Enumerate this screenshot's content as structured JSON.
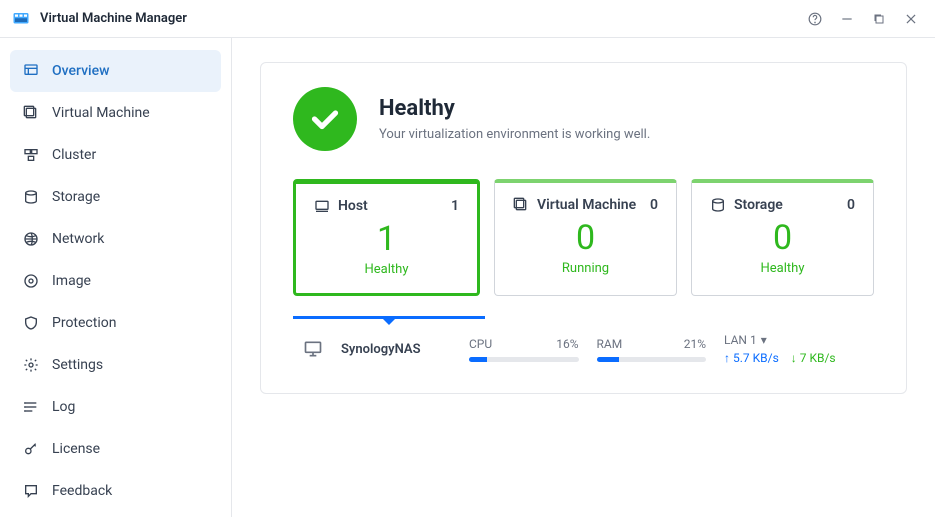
{
  "app": {
    "title": "Virtual Machine Manager"
  },
  "sidebar": {
    "items": [
      {
        "label": "Overview"
      },
      {
        "label": "Virtual Machine"
      },
      {
        "label": "Cluster"
      },
      {
        "label": "Storage"
      },
      {
        "label": "Network"
      },
      {
        "label": "Image"
      },
      {
        "label": "Protection"
      },
      {
        "label": "Settings"
      },
      {
        "label": "Log"
      },
      {
        "label": "License"
      },
      {
        "label": "Feedback"
      }
    ]
  },
  "health": {
    "title": "Healthy",
    "subtitle": "Your virtualization environment is working well."
  },
  "cards": {
    "host": {
      "label": "Host",
      "count": "1",
      "big": "1",
      "status": "Healthy"
    },
    "vm": {
      "label": "Virtual Machine",
      "count": "0",
      "big": "0",
      "status": "Running"
    },
    "storage": {
      "label": "Storage",
      "count": "0",
      "big": "0",
      "status": "Healthy"
    }
  },
  "host": {
    "name": "SynologyNAS",
    "cpu_label": "CPU",
    "cpu_pct_text": "16%",
    "cpu_pct": 16,
    "ram_label": "RAM",
    "ram_pct_text": "21%",
    "ram_pct": 21,
    "net_label": "LAN 1",
    "up": "5.7 KB/s",
    "down": "7 KB/s"
  }
}
